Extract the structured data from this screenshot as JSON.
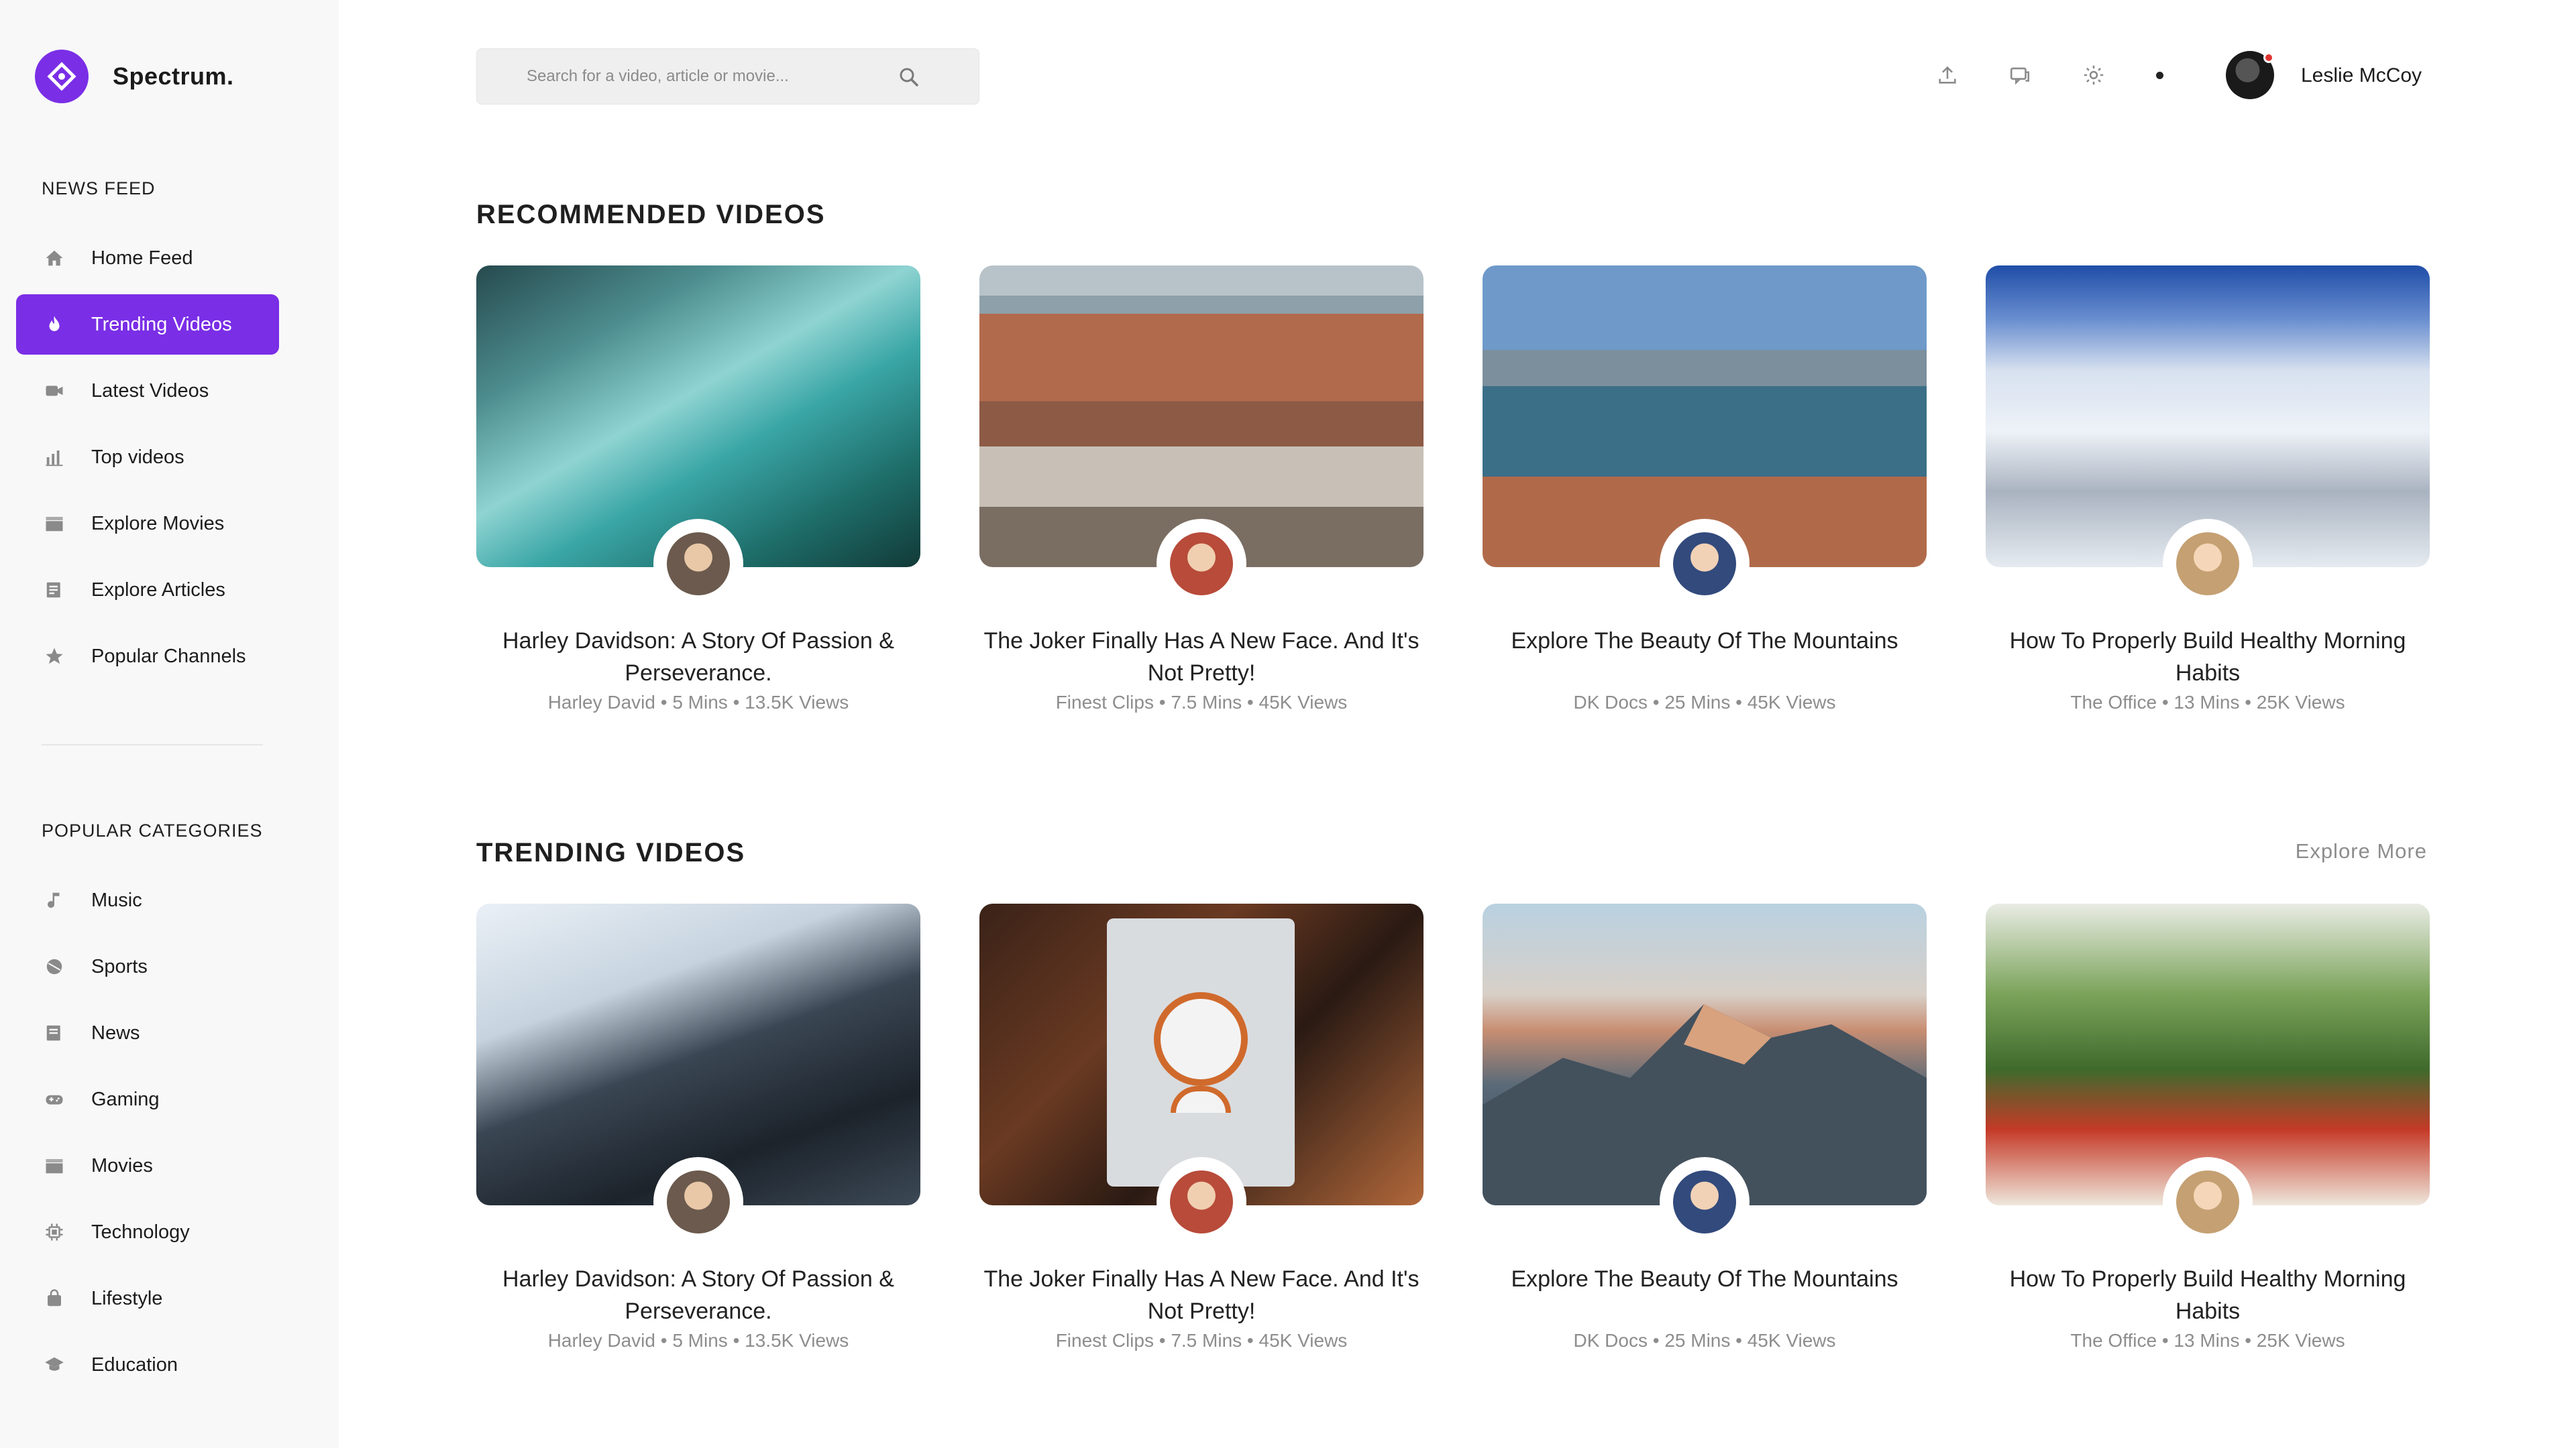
{
  "app": {
    "name": "Spectrum."
  },
  "sidebar": {
    "news_feed_title": "NEWS FEED",
    "news_items": [
      {
        "label": "Home Feed",
        "icon": "home-icon",
        "active": false
      },
      {
        "label": "Trending Videos",
        "icon": "flame-icon",
        "active": true
      },
      {
        "label": "Latest Videos",
        "icon": "video-camera-icon",
        "active": false
      },
      {
        "label": "Top videos",
        "icon": "bar-chart-icon",
        "active": false
      },
      {
        "label": "Explore Movies",
        "icon": "clapperboard-icon",
        "active": false
      },
      {
        "label": "Explore Articles",
        "icon": "article-icon",
        "active": false
      },
      {
        "label": "Popular Channels",
        "icon": "star-icon",
        "active": false
      }
    ],
    "categories_title": "POPULAR CATEGORIES",
    "categories": [
      {
        "label": "Music",
        "icon": "music-note-icon"
      },
      {
        "label": "Sports",
        "icon": "ball-icon"
      },
      {
        "label": "News",
        "icon": "newspaper-icon"
      },
      {
        "label": "Gaming",
        "icon": "gamepad-icon"
      },
      {
        "label": "Movies",
        "icon": "clapperboard-icon"
      },
      {
        "label": "Technology",
        "icon": "chip-icon"
      },
      {
        "label": "Lifestyle",
        "icon": "bag-icon"
      },
      {
        "label": "Education",
        "icon": "graduation-cap-icon"
      }
    ],
    "accent_color": "#7a2ee6"
  },
  "header": {
    "search_placeholder": "Search for a video, article or movie...",
    "user_name": "Leslie McCoy"
  },
  "recommended": {
    "title": "RECOMMENDED VIDEOS",
    "cards": [
      {
        "title": "Harley Davidson: A Story Of Passion & Perseverance.",
        "meta": "Harley David • 5 Mins • 13.5K Views"
      },
      {
        "title": "The Joker Finally Has A New Face. And It's Not Pretty!",
        "meta": "Finest Clips • 7.5 Mins • 45K Views"
      },
      {
        "title": "Explore The Beauty Of The Mountains",
        "meta": "DK Docs • 25 Mins • 45K Views"
      },
      {
        "title": "How To Properly Build Healthy Morning Habits",
        "meta": "The Office • 13 Mins • 25K Views"
      }
    ]
  },
  "trending": {
    "title": "TRENDING VIDEOS",
    "explore_more": "Explore More",
    "cards": [
      {
        "title": "Harley Davidson: A Story Of Passion & Perseverance.",
        "meta": "Harley David • 5 Mins • 13.5K Views"
      },
      {
        "title": "The Joker Finally Has A New Face. And It's Not Pretty!",
        "meta": "Finest Clips • 7.5 Mins • 45K Views"
      },
      {
        "title": "Explore The Beauty Of The Mountains",
        "meta": "DK Docs • 25 Mins • 45K Views"
      },
      {
        "title": "How To Properly Build Healthy Morning Habits",
        "meta": "The Office • 13 Mins • 25K Views"
      }
    ]
  }
}
